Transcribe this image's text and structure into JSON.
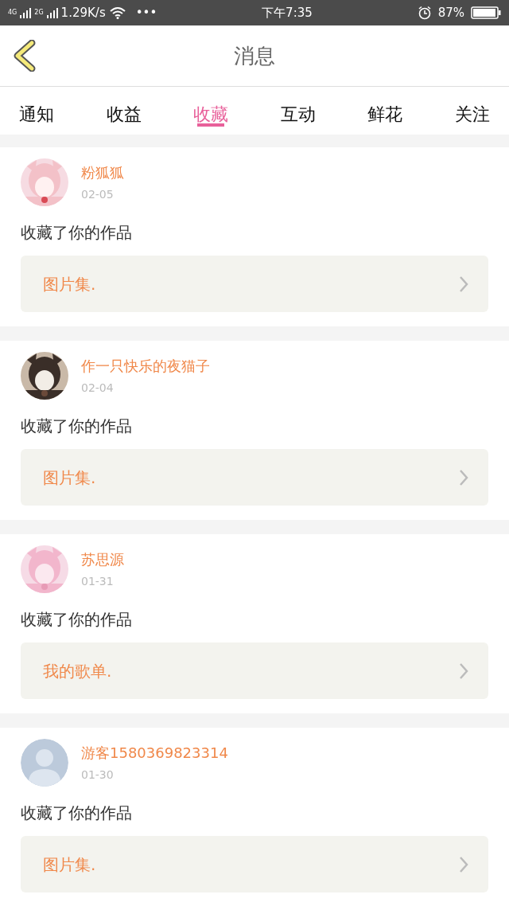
{
  "status_bar": {
    "network_1": "4G",
    "network_2": "2G",
    "speed": "1.29K/s",
    "more": "•••",
    "time": "下午7:35",
    "battery": "87%"
  },
  "header": {
    "title": "消息"
  },
  "tabs": [
    {
      "label": "通知",
      "selected": false
    },
    {
      "label": "收益",
      "selected": false
    },
    {
      "label": "收藏",
      "selected": true
    },
    {
      "label": "互动",
      "selected": false
    },
    {
      "label": "鲜花",
      "selected": false
    },
    {
      "label": "关注",
      "selected": false
    }
  ],
  "messages": [
    {
      "name": "粉狐狐",
      "date": "02-05",
      "text": "收藏了你的作品",
      "item": "图片集."
    },
    {
      "name": "作一只快乐的夜猫子",
      "date": "02-04",
      "text": "收藏了你的作品",
      "item": "图片集."
    },
    {
      "name": "苏思源",
      "date": "01-31",
      "text": "收藏了你的作品",
      "item": "我的歌单."
    },
    {
      "avatar": {
        "kind": "default"
      },
      "name": "游客1580369823314",
      "date": "01-30",
      "text": "收藏了你的作品",
      "item": "图片集."
    }
  ]
}
